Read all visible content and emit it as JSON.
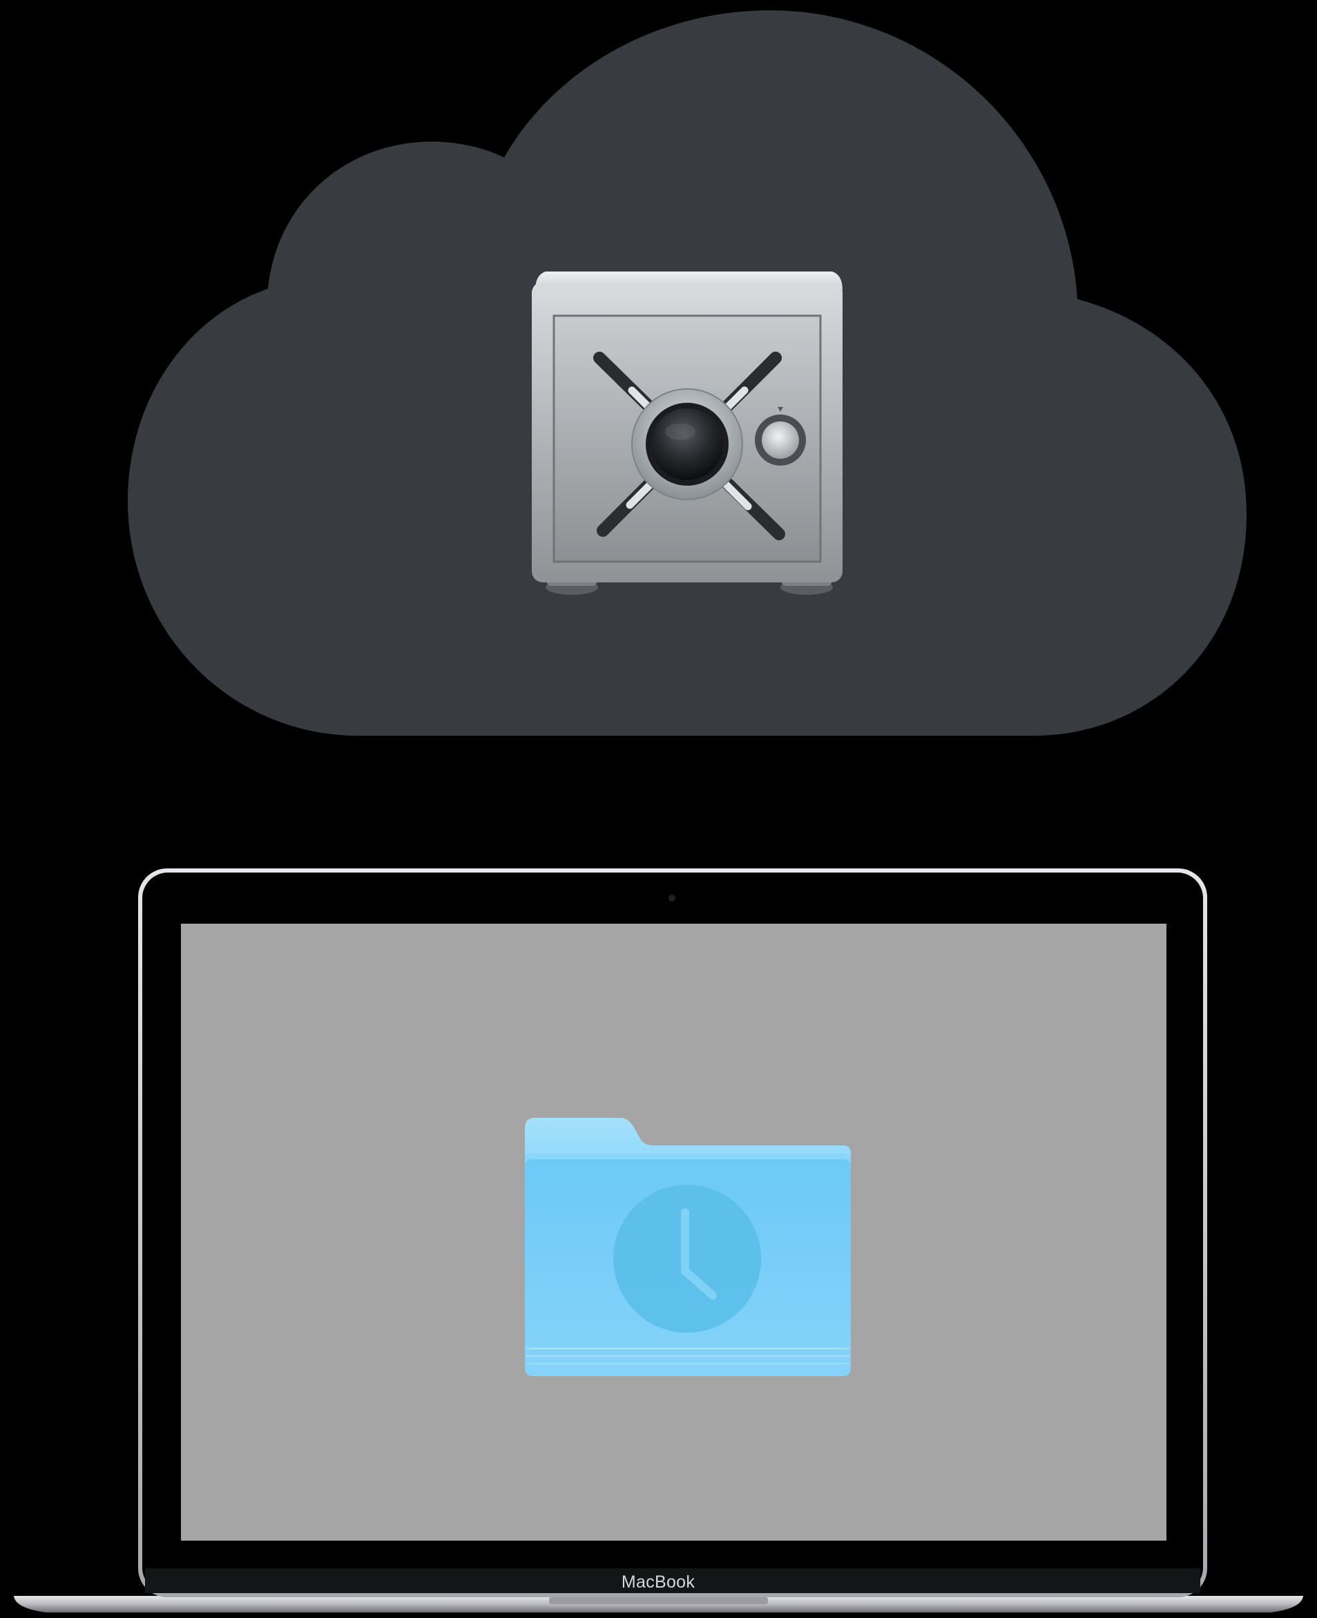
{
  "device": {
    "brand_label": "MacBook"
  },
  "icons": {
    "cloud": "cloud-icon",
    "safe": "safe-vault-icon",
    "folder": "time-machine-folder-icon",
    "clock": "clock-icon"
  },
  "colors": {
    "background": "#000000",
    "cloud": "#383c41",
    "screen": "#a5a5a5",
    "folder": "#7acdf5",
    "laptop_frame": "#d0d0d4"
  }
}
